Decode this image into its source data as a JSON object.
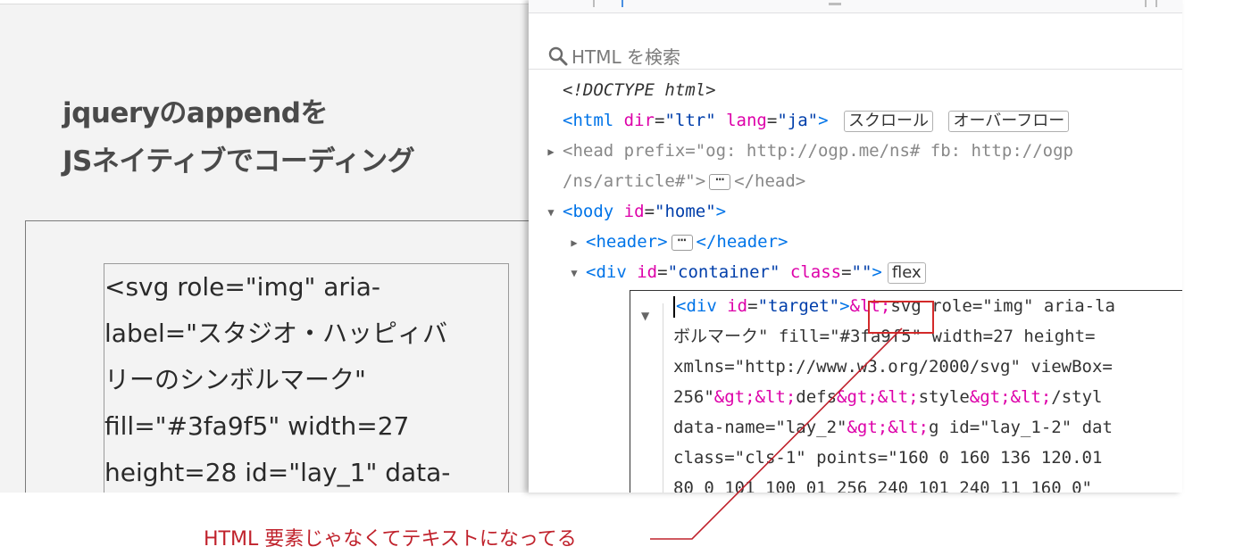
{
  "page": {
    "heading_line1": "jqueryのappendを",
    "heading_line2": "JSネイティブでコーディング",
    "inner_lines": [
      "<svg role=\"img\" aria-",
      "label=\"スタジオ・ハッピィバ",
      "リーのシンボルマーク\"",
      "fill=\"#3fa9f5\" width=27",
      "height=28 id=\"lay_1\" data-"
    ]
  },
  "devtools": {
    "search_placeholder": "HTML を検索",
    "search_icon": "search-icon",
    "doctype": "<!DOCTYPE html>",
    "html_tag": "html",
    "html_attr1_name": "dir",
    "html_attr1_val": "\"ltr\"",
    "html_attr2_name": "lang",
    "html_attr2_val": "\"ja\"",
    "badge_scroll": "スクロール",
    "badge_overflow": "オーバーフロー",
    "head_line1": "<head prefix=\"og: http://ogp.me/ns# fb: http://ogp",
    "head_line2": "/ns/article#\">",
    "head_close": "</head>",
    "body_tag": "body",
    "body_attr_name": "id",
    "body_attr_val": "\"home\"",
    "header_open": "<header>",
    "header_close": "</header>",
    "div_tag": "div",
    "div_attr1_name": "id",
    "div_attr1_val": "\"container\"",
    "div_attr2_name": "class",
    "div_attr2_val": "\"\"",
    "badge_flex": "flex",
    "sel_line1_tag": "div",
    "sel_line1_attr": "id",
    "sel_line1_val": "\"target\"",
    "sel_line1_ent": "&lt;",
    "sel_line1_rest": "svg role=\"img\" aria-la",
    "sel_line2": "ボルマーク\" fill=\"#3fa9f5\" width=27 height=",
    "sel_line3": "xmlns=\"http://www.w3.org/2000/svg\" viewBox=",
    "sel_line4_a": "256\"",
    "sel_line4_b": "&gt;&lt;",
    "sel_line4_c": "defs",
    "sel_line4_d": "&gt;&lt;",
    "sel_line4_e": "style",
    "sel_line4_f": "&gt;&lt;",
    "sel_line4_g": "/styl",
    "sel_line5_a": "data-name=\"lay_2\"",
    "sel_line5_b": "&gt;&lt;",
    "sel_line5_c": "g id=\"lay_1-2\" dat",
    "sel_line6": "class=\"cls-1\" points=\"160 0 160 136 120.01",
    "sel_line7": "80 0 101 100 01 256 240 101 240 11 160 0\""
  },
  "annotation": {
    "text": "HTML 要素じゃなくてテキストになってる",
    "color": "#c0222c"
  },
  "colors": {
    "tag": "#0074e8",
    "attr": "#dd00a9",
    "value": "#003eaa",
    "highlight": "#d32a2a"
  }
}
